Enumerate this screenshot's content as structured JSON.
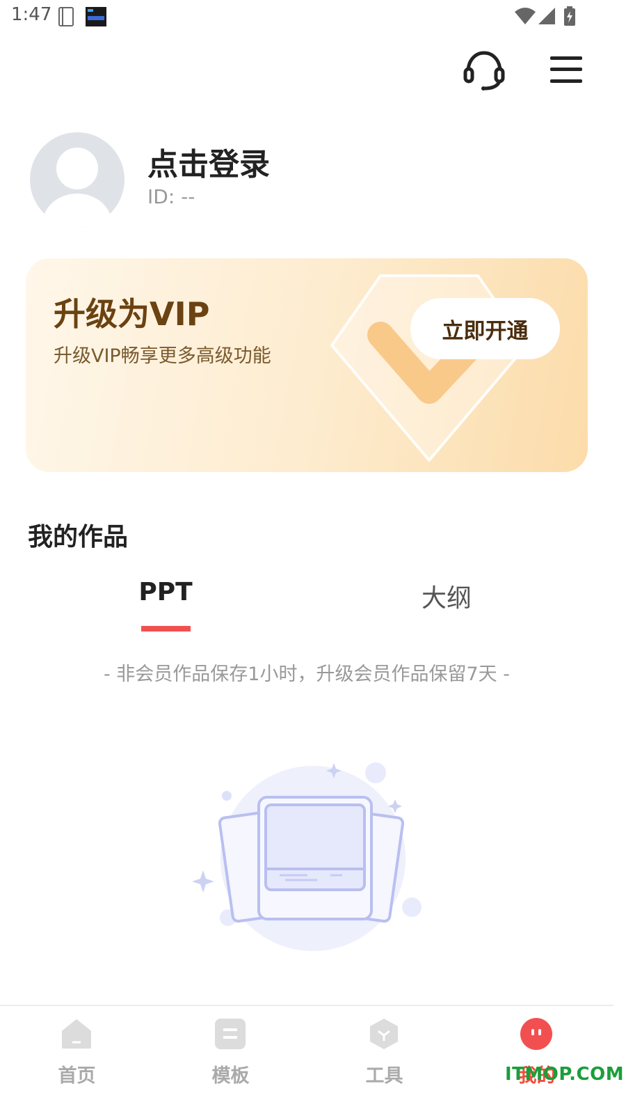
{
  "status_bar": {
    "time": "1:47",
    "icons": [
      "notebook-icon",
      "app-thumbnail-icon",
      "wifi-icon",
      "cellular-signal-icon",
      "battery-charging-icon"
    ]
  },
  "header": {
    "icons": [
      "headset-icon",
      "menu-icon"
    ]
  },
  "profile": {
    "login_text": "点击登录",
    "id_text": "ID: --"
  },
  "vip_card": {
    "title": "升级为VIP",
    "subtitle": "升级VIP畅享更多高级功能",
    "button_label": "立即开通"
  },
  "works": {
    "title": "我的作品",
    "tabs": [
      {
        "label": "PPT",
        "active": true
      },
      {
        "label": "大纲",
        "active": false
      }
    ],
    "notice": "- 非会员作品保存1小时，升级会员作品保留7天 -"
  },
  "bottom_nav": {
    "items": [
      {
        "label": "首页",
        "icon": "home-icon",
        "active": false
      },
      {
        "label": "模板",
        "icon": "template-icon",
        "active": false
      },
      {
        "label": "工具",
        "icon": "tools-icon",
        "active": false
      },
      {
        "label": "我的",
        "icon": "profile-face-icon",
        "active": true
      }
    ]
  },
  "watermark": "ITMOP.COM",
  "colors": {
    "accent": "#f25050",
    "vip_text": "#6b4212",
    "nav_inactive": "#aaaaaa",
    "nav_active": "#f44b3b"
  }
}
